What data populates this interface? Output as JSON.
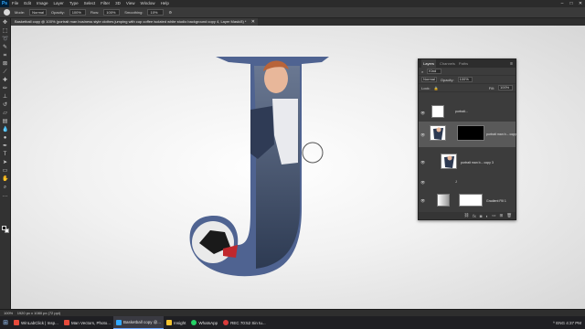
{
  "app": {
    "logo": "Ps",
    "menu": [
      "File",
      "Edit",
      "Image",
      "Layer",
      "Type",
      "Select",
      "Filter",
      "3D",
      "View",
      "Window",
      "Help"
    ],
    "window_controls": [
      "–",
      "□",
      "✕"
    ]
  },
  "options_bar": {
    "mode_label": "Mode:",
    "mode_value": "Normal",
    "opacity_label": "Opacity:",
    "opacity_value": "100%",
    "flow_label": "Flow:",
    "flow_value": "100%",
    "smoothing_label": "Smoothing:",
    "smoothing_value": "10%"
  },
  "document": {
    "tab_title": "Basketball copy @ 100% (portrait man business style clothes jumping with cup coffee isolated white studio background copy 4, Layer Mask/8) *",
    "close": "✕"
  },
  "layers_panel": {
    "tabs": [
      "Layers",
      "Channels",
      "Paths"
    ],
    "menu_icon": "≡",
    "kind_label": "Kind",
    "blend_mode": "Normal",
    "opacity_label": "Opacity:",
    "opacity_value": "100%",
    "lock_label": "Lock:",
    "fill_label": "Fill:",
    "fill_value": "100%",
    "layers": [
      {
        "name": "portrait..."
      },
      {
        "name": "portrait man b... copy 4"
      },
      {
        "name": "portrait man b... copy 3"
      },
      {
        "name": "J"
      },
      {
        "name": "Gradient Fill 1"
      }
    ],
    "footer_icons": [
      "link-icon",
      "fx-icon",
      "mask-icon",
      "adjustment-icon",
      "group-icon",
      "new-layer-icon",
      "trash-icon"
    ]
  },
  "status_bar": {
    "zoom": "100%",
    "doc_info": "1920 px x 1080 px (72 ppi)"
  },
  "taskbar": {
    "items": [
      {
        "label": "WinLabClick | Insp..."
      },
      {
        "label": "Man Vectors, Photo..."
      },
      {
        "label": "Basketball copy @..."
      },
      {
        "label": "Insight"
      },
      {
        "label": "WhatsApp"
      },
      {
        "label": "REC 70:52 Sin tu..."
      }
    ],
    "tray": "^  ENG  4:37 PM"
  },
  "colors": {
    "letter_fill": "#4f6391",
    "canvas_bg": "#f1f1f1",
    "accent": "#31a8ff"
  }
}
